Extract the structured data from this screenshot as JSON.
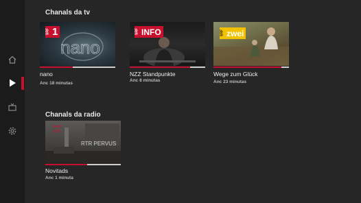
{
  "sidebar": {
    "items": [
      {
        "name": "home-icon"
      },
      {
        "name": "play-icon",
        "active": true
      },
      {
        "name": "tv-icon"
      },
      {
        "name": "gear-icon"
      }
    ]
  },
  "sections": {
    "tv": {
      "title": "Chanals da tv",
      "cards": [
        {
          "title": "nano",
          "meta": "Anc 18 minutas",
          "logo": "1",
          "progress": 0.44
        },
        {
          "title": "NZZ Standpunkte",
          "meta": "Anc 8 minutas",
          "logo": "INFO",
          "progress": 0.8
        },
        {
          "title": "Wege zum Glück",
          "meta": "Anc 23 minutas",
          "logo": "zwei",
          "progress": 0.9
        }
      ]
    },
    "radio": {
      "title": "Chanals da radio",
      "cards": [
        {
          "title": "Novitads",
          "meta": "Anc 1 minuta",
          "logo_text": "Radio RTR",
          "overlay": "RTR PERVUS",
          "progress": 0.55
        }
      ]
    }
  },
  "colors": {
    "accent": "#c8102e",
    "background": "#262626",
    "sidebar": "#1b1b1b"
  }
}
